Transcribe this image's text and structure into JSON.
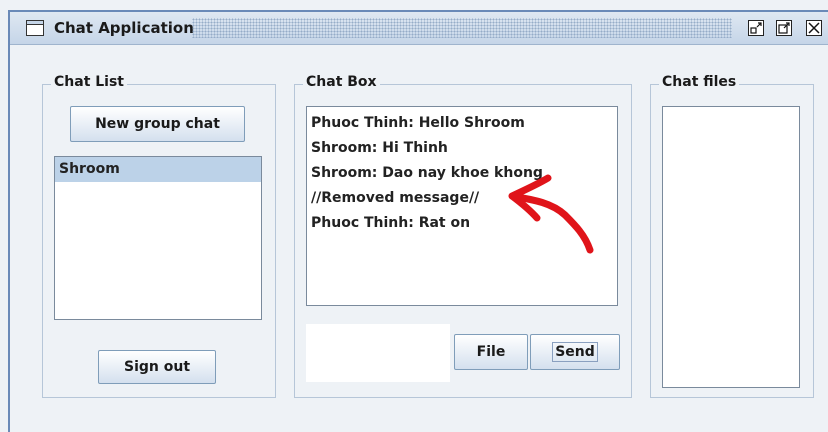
{
  "window": {
    "title": "Chat Application",
    "controls": {
      "minimize": "▫",
      "maximize": "◱",
      "close": "✕"
    }
  },
  "chat_list": {
    "legend": "Chat List",
    "new_group_label": "New group chat",
    "items": [
      {
        "label": "Shroom",
        "selected": true
      }
    ],
    "sign_out_label": "Sign out"
  },
  "chat_box": {
    "legend": "Chat Box",
    "messages": [
      "Phuoc Thinh: Hello Shroom",
      "Shroom: Hi Thinh",
      "Shroom: Dao nay khoe khong",
      "//Removed message//",
      "Phuoc Thinh: Rat on"
    ],
    "input_value": "",
    "file_label": "File",
    "send_label": "Send"
  },
  "chat_files": {
    "legend": "Chat files",
    "items": []
  },
  "annotation": {
    "color": "#e0141a",
    "icon": "red-arrow-annotation"
  }
}
